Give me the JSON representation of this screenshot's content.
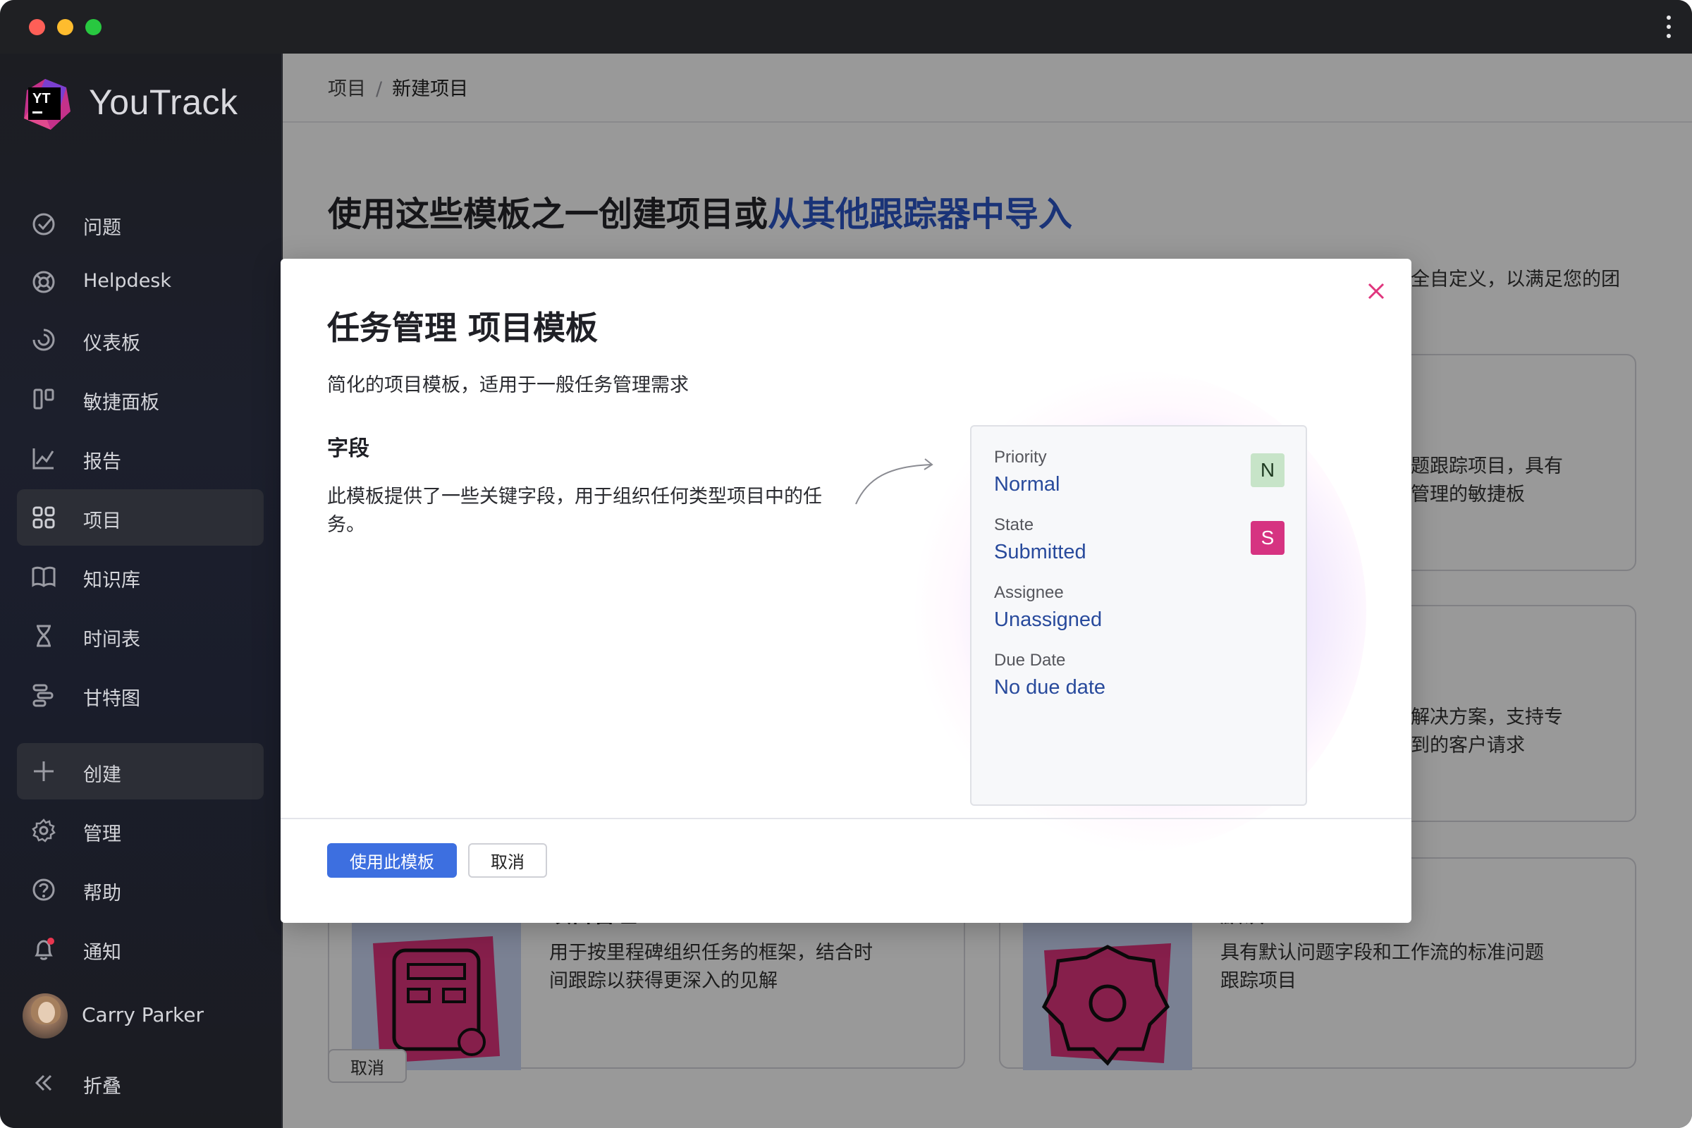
{
  "app": {
    "name": "YouTrack",
    "logo_text": "YT"
  },
  "sidebar": {
    "items": [
      {
        "label": "问题",
        "icon": "check-circle-icon"
      },
      {
        "label": "Helpdesk",
        "icon": "lifebuoy-icon"
      },
      {
        "label": "仪表板",
        "icon": "dashboard-icon"
      },
      {
        "label": "敏捷面板",
        "icon": "agile-board-icon"
      },
      {
        "label": "报告",
        "icon": "chart-line-icon"
      },
      {
        "label": "项目",
        "icon": "grid-icon",
        "active": true
      },
      {
        "label": "知识库",
        "icon": "book-icon"
      },
      {
        "label": "时间表",
        "icon": "hourglass-icon"
      },
      {
        "label": "甘特图",
        "icon": "gantt-icon"
      }
    ],
    "bottom": [
      {
        "label": "创建",
        "icon": "plus-icon"
      },
      {
        "label": "管理",
        "icon": "gear-icon"
      },
      {
        "label": "帮助",
        "icon": "help-icon"
      },
      {
        "label": "通知",
        "icon": "bell-icon"
      }
    ],
    "user_name": "Carry Parker",
    "collapse_label": "折叠"
  },
  "main": {
    "breadcrumb": [
      "项目",
      "新建项目"
    ],
    "title_prefix": "使用这些模板之一创建项目或",
    "title_link": "从其他跟踪器中导入",
    "bg_desc_fragment": "全自定义，以满足您的团",
    "cards": [
      {
        "fragment_1": "题跟踪项目，具有",
        "fragment_2": "管理的敏捷板"
      },
      {
        "fragment_1": "解决方案，支持专",
        "fragment_2": "到的客户请求"
      },
      {
        "title": "项目管理",
        "desc_1": "用于按里程碑组织任务的框架，结合时",
        "desc_2": "间跟踪以获得更深入的见解"
      },
      {
        "title": "默认",
        "desc_1": "具有默认问题字段和工作流的标准问题",
        "desc_2": "跟踪项目"
      }
    ],
    "cancel_label": "取消"
  },
  "modal": {
    "title": "任务管理 项目模板",
    "subtitle": "简化的项目模板，适用于一般任务管理需求",
    "section_title": "字段",
    "section_desc": "此模板提供了一些关键字段，用于组织任何类型项目中的任务。",
    "fields": [
      {
        "label": "Priority",
        "value": "Normal",
        "badge": "N"
      },
      {
        "label": "State",
        "value": "Submitted",
        "badge": "S"
      },
      {
        "label": "Assignee",
        "value": "Unassigned"
      },
      {
        "label": "Due Date",
        "value": "No due date"
      }
    ],
    "primary_button": "使用此模板",
    "cancel_button": "取消"
  },
  "colors": {
    "accent": "#3d6fe0",
    "link": "#2c55c6",
    "badge_normal": "#c7e4c8",
    "badge_submitted": "#d63381",
    "close_icon": "#e0357d"
  }
}
